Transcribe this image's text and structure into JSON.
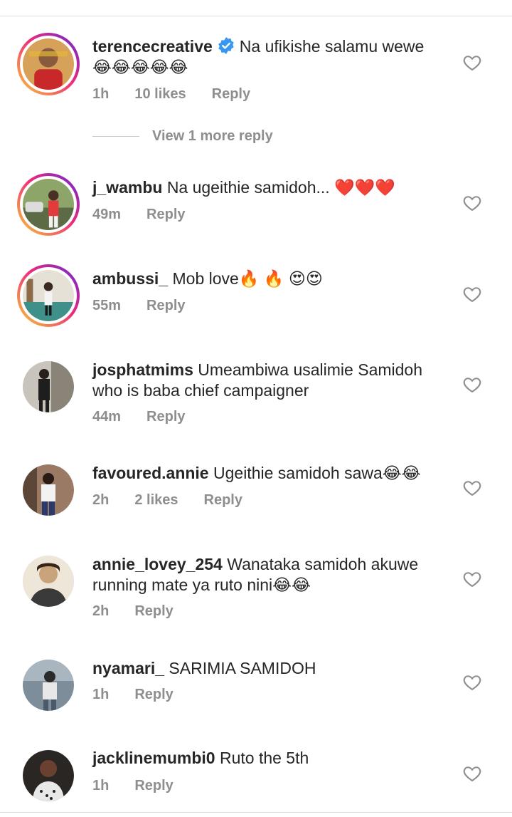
{
  "comments": [
    {
      "username": "terencecreative",
      "verified": true,
      "text": "Na ufikishe salamu wewe",
      "emojis": "😂😂😂😂😂",
      "time": "1h",
      "likes": "10 likes",
      "reply": "Reply",
      "story_ring": true,
      "avatar_color": "#c8282a"
    },
    {
      "username": "j_wambu",
      "verified": false,
      "text": "Na ugeithie samidoh...",
      "emojis": "❤️❤️❤️",
      "time": "49m",
      "likes": "",
      "reply": "Reply",
      "story_ring": true,
      "avatar_color": "#5a6b45"
    },
    {
      "username": "ambussi_",
      "verified": false,
      "text": "Mob love",
      "emojis": "🔥 🔥 😍😍",
      "time": "55m",
      "likes": "",
      "reply": "Reply",
      "story_ring": true,
      "avatar_color": "#3f8f8a"
    },
    {
      "username": "josphatmims",
      "verified": false,
      "text": "Umeambiwa usalimie Samidoh who is baba chief campaigner",
      "emojis": "",
      "time": "44m",
      "likes": "",
      "reply": "Reply",
      "story_ring": false,
      "avatar_color": "#4a4a4a"
    },
    {
      "username": "favoured.annie",
      "verified": false,
      "text": "Ugeithie samidoh sawa",
      "emojis": "😂😂",
      "time": "2h",
      "likes": "2 likes",
      "reply": "Reply",
      "story_ring": false,
      "avatar_color": "#6d5346"
    },
    {
      "username": "annie_lovey_254",
      "verified": false,
      "text": "Wanataka samidoh akuwe running mate ya ruto nini",
      "emojis": "😂😂",
      "time": "2h",
      "likes": "",
      "reply": "Reply",
      "story_ring": false,
      "avatar_color": "#c9a47a"
    },
    {
      "username": "nyamari_",
      "verified": false,
      "text": "SARIMIA SAMIDOH",
      "emojis": "",
      "time": "1h",
      "likes": "",
      "reply": "Reply",
      "story_ring": false,
      "avatar_color": "#7d8d99"
    },
    {
      "username": "jacklinemumbi0",
      "verified": false,
      "text": "Ruto the 5th",
      "emojis": "",
      "time": "1h",
      "likes": "",
      "reply": "Reply",
      "story_ring": false,
      "avatar_color": "#2a2624"
    }
  ],
  "view_more_replies": "View 1 more reply",
  "colors": {
    "text": "#262626",
    "meta": "#8e8e8e",
    "divider": "#dbdbdb",
    "verified": "#3897f0"
  }
}
